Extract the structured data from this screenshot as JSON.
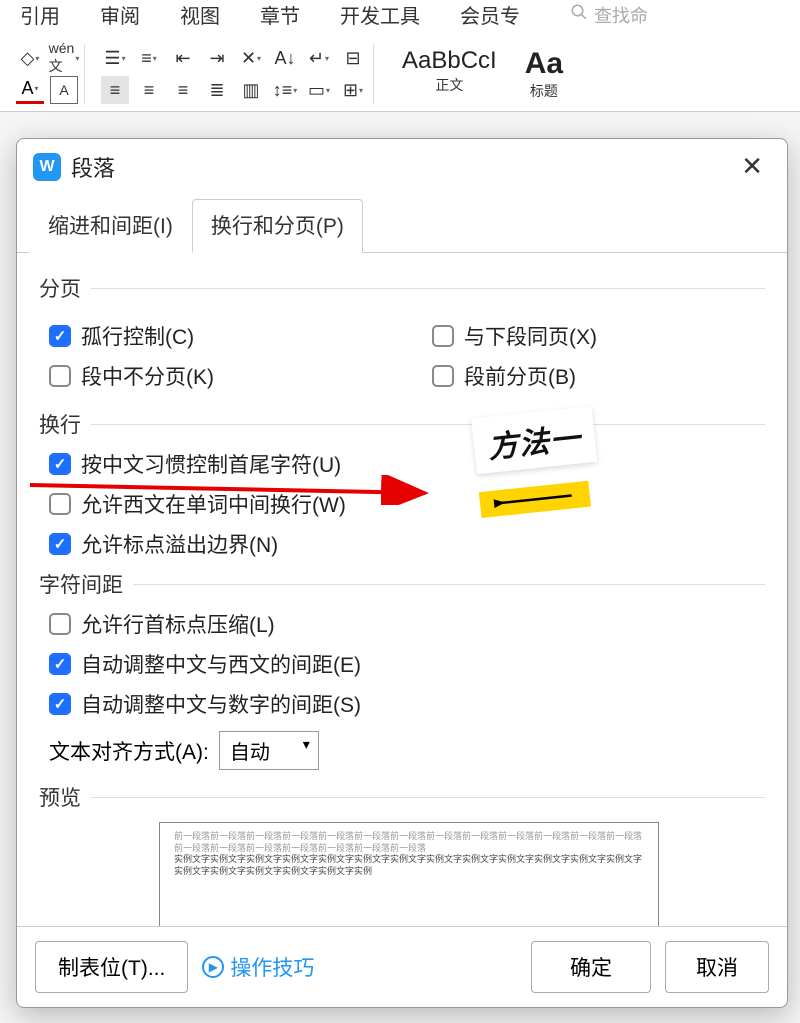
{
  "ribbon": {
    "tabs": [
      "引用",
      "审阅",
      "视图",
      "章节",
      "开发工具",
      "会员专"
    ],
    "search_placeholder": "查找命",
    "styles": {
      "normal_sample": "AaBbCcI",
      "normal_label": "正文",
      "heading_sample": "Aa",
      "heading_label": "标题"
    }
  },
  "dialog": {
    "title": "段落",
    "tabs": {
      "indent": "缩进和间距(I)",
      "break": "换行和分页(P)"
    },
    "sections": {
      "paging": "分页",
      "linebreak": "换行",
      "spacing": "字符间距",
      "preview": "预览"
    },
    "checks": {
      "orphan": "孤行控制(C)",
      "keep_next": "与下段同页(X)",
      "no_break": "段中不分页(K)",
      "page_before": "段前分页(B)",
      "cjk_firstlast": "按中文习惯控制首尾字符(U)",
      "latin_wrap": "允许西文在单词中间换行(W)",
      "punct_overflow": "允许标点溢出边界(N)",
      "punct_compress": "允许行首标点压缩(L)",
      "cjk_latin_space": "自动调整中文与西文的间距(E)",
      "cjk_digit_space": "自动调整中文与数字的间距(S)"
    },
    "align_label": "文本对齐方式(A):",
    "align_value": "自动",
    "preview_grey": "前一段落前一段落前一段落前一段落前一段落前一段落前一段落前一段落前一段落前一段落前一段落前一段落前一段落前一段落前一段落前一段落前一段落前一段落前一段落前一段落",
    "preview_dark": "实例文字实例文字实例文字实例文字实例文字实例文字实例文字实例文字实例文字实例文字实例文字实例文字实例文字实例文字实例文字实例文字实例文字实例文字实例",
    "footer": {
      "tabstops": "制表位(T)...",
      "tips": "操作技巧",
      "ok": "确定",
      "cancel": "取消"
    }
  },
  "annotation": {
    "label": "方法一"
  }
}
